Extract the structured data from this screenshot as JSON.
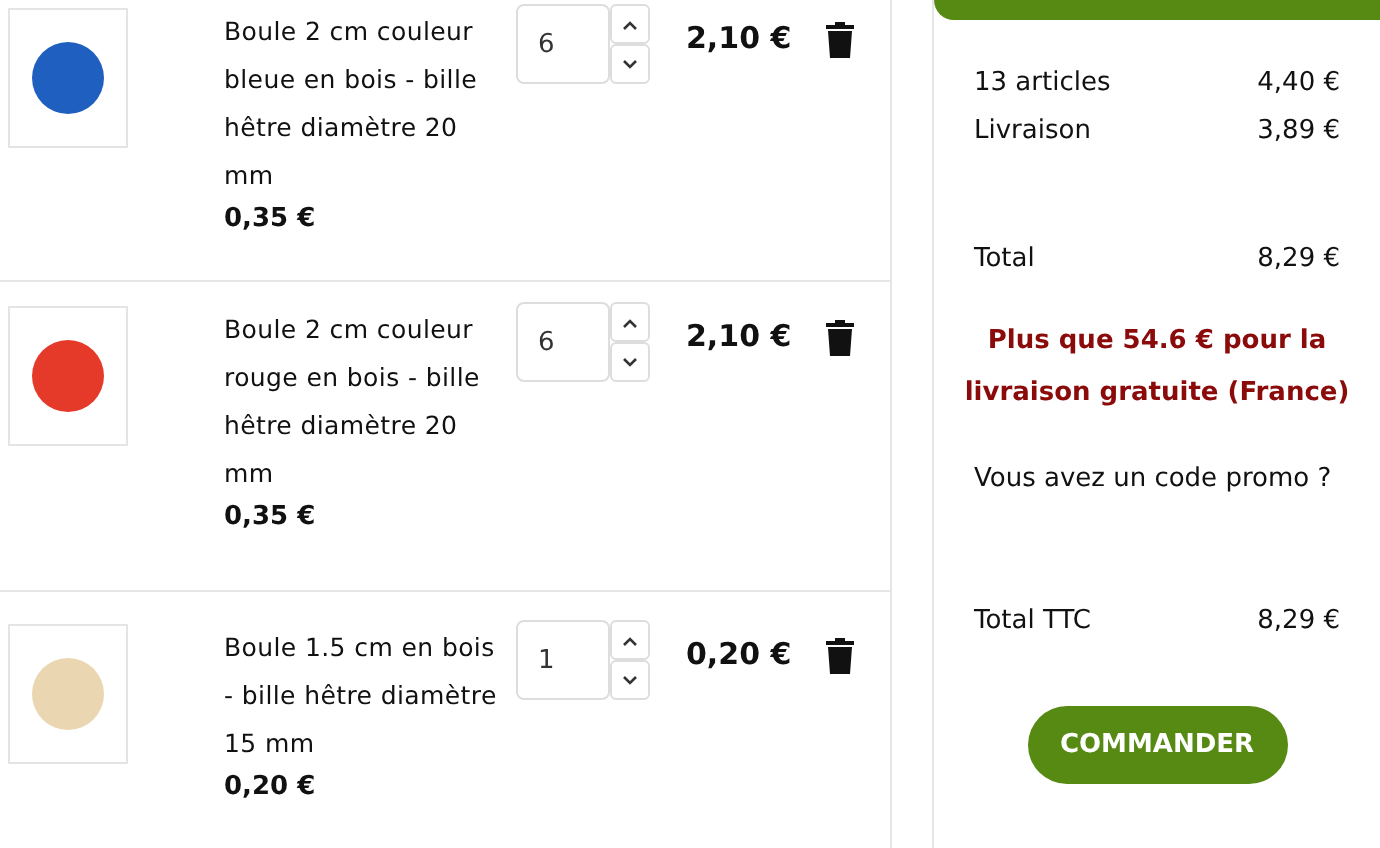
{
  "cart_items": [
    {
      "name": "Boule 2 cm couleur bleue en bois - bille hêtre diamètre 20 mm",
      "unit_price": "0,35 €",
      "quantity": "6",
      "total": "2,10 €",
      "color": "#1f5fbf"
    },
    {
      "name": "Boule 2 cm couleur rouge en bois - bille hêtre diamètre 20 mm",
      "unit_price": "0,35 €",
      "quantity": "6",
      "total": "2,10 €",
      "color": "#e53a2a"
    },
    {
      "name": "Boule 1.5 cm en bois - bille hêtre diamètre 15 mm",
      "unit_price": "0,20 €",
      "quantity": "1",
      "total": "0,20 €",
      "color": "#ead6b0"
    }
  ],
  "summary": {
    "lines": [
      {
        "label": "13 articles",
        "value": "4,40 €"
      },
      {
        "label": "Livraison",
        "value": "3,89 €"
      }
    ],
    "total": {
      "label": "Total",
      "value": "8,29 €"
    },
    "free_shipping_note": "Plus que 54.6 € pour la livraison gratuite (France)",
    "promo_link": "Vous avez un code promo ?",
    "total_ttc": {
      "label": "Total TTC",
      "value": "8,29 €"
    },
    "order_button": "COMMANDER"
  }
}
